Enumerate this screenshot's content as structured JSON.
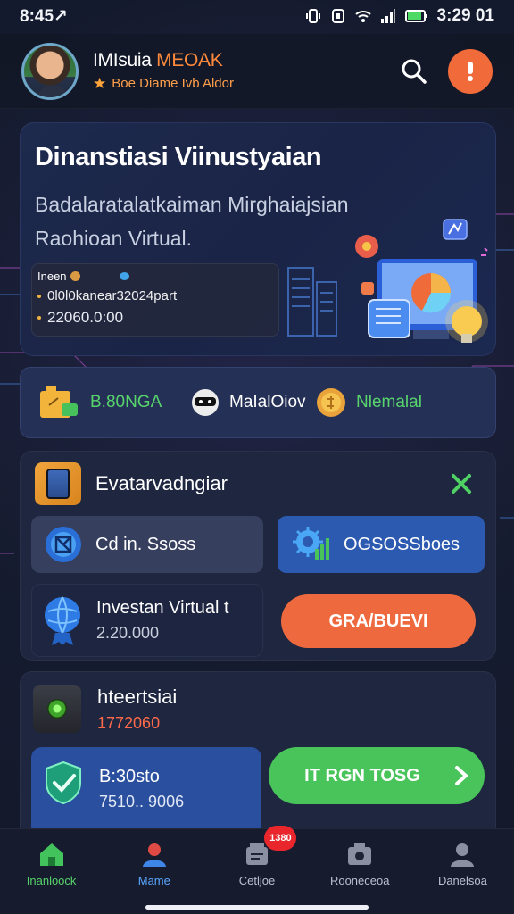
{
  "status_bar": {
    "time_left": "8:45↗",
    "time_right": "3:29 01"
  },
  "header": {
    "name_part1": "IMIsuia ",
    "name_part2": "MEOAK",
    "subtitle": "Boe Diame Ivb Aldor"
  },
  "hero": {
    "title": "Dinanstiasi Viinustyaian",
    "subtitle_line1": "Badalaratalatkaiman Mirghaiajsian",
    "subtitle_line2": "Raohioan Virtual.",
    "mini": {
      "head": "Ineen",
      "line1": "0l0l0kanear32024part",
      "line2": "22060.0:00"
    }
  },
  "categories": [
    {
      "label": "B.80NGA",
      "color": "#58d46c"
    },
    {
      "label": "MaIalOiov",
      "color": "#ffffff"
    },
    {
      "label": "Nlemalal",
      "color": "#58d46c"
    }
  ],
  "panel_b": {
    "title": "Evatarvadngiar",
    "option_left": "Cd in. Ssoss",
    "option_right": "OGSOSSboes",
    "invest_title": "Investan Virtual t",
    "invest_value": "2.20.000",
    "cta": "GRA/BUEVI"
  },
  "panel_c": {
    "title": "hteertsiai",
    "value": "1772060",
    "sec_title": "B:30sto",
    "sec_value": "7510.. 9006",
    "cta": "IT RGN TOSG"
  },
  "bottom_nav": {
    "items": [
      {
        "label": "Inanloock"
      },
      {
        "label": "Mame"
      },
      {
        "label": "Cetljoe"
      },
      {
        "label": "Rooneceoa"
      },
      {
        "label": "Danelsoa"
      }
    ],
    "badge": "1380"
  },
  "colors": {
    "accent_orange": "#ee6a3e",
    "accent_green": "#48c45a",
    "accent_blue": "#2c5ab0"
  }
}
